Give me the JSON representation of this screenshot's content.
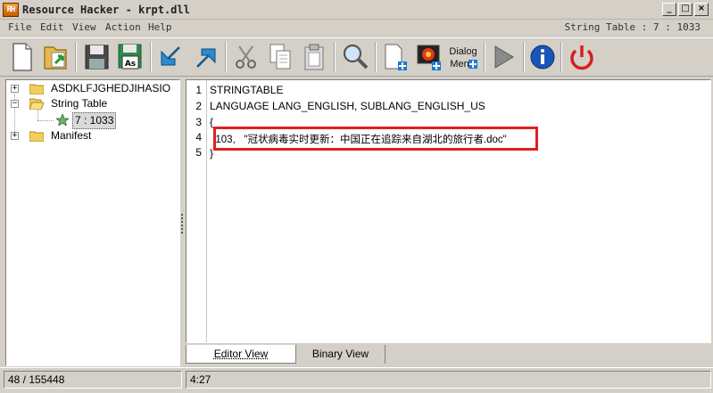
{
  "window": {
    "app_icon_text": "RH",
    "title": "Resource Hacker - krpt.dll",
    "min_glyph": "_",
    "max_glyph": "□",
    "close_glyph": "×"
  },
  "menu": {
    "file": "File",
    "edit": "Edit",
    "view": "View",
    "action": "Action",
    "help": "Help",
    "status": "String Table : 7 : 1033"
  },
  "toolbar": {
    "buttons": [
      {
        "name": "new-icon"
      },
      {
        "name": "open-folder-icon"
      },
      {
        "name": "save-icon"
      },
      {
        "name": "save-as-icon",
        "label": "As"
      },
      {
        "name": "import-arrow-icon"
      },
      {
        "name": "export-arrow-icon"
      },
      {
        "name": "cut-icon"
      },
      {
        "name": "copy-icon"
      },
      {
        "name": "paste-icon"
      },
      {
        "name": "find-icon"
      },
      {
        "name": "add-resource-icon"
      },
      {
        "name": "add-image-resource-icon"
      },
      {
        "name": "dialog-menu-icon"
      },
      {
        "name": "compile-run-icon"
      },
      {
        "name": "info-icon"
      },
      {
        "name": "power-icon"
      }
    ],
    "dialog_label_1": "Dialog",
    "dialog_label_2": "Men"
  },
  "tree": {
    "items": [
      {
        "label": "ASDKLFJGHEDJIHASIO",
        "expander": "+"
      },
      {
        "label": "String Table",
        "expander": "−"
      },
      {
        "label": "7 : 1033"
      },
      {
        "label": "Manifest",
        "expander": "+"
      }
    ]
  },
  "editor": {
    "line_numbers": [
      "1",
      "2",
      "3",
      "4",
      "5"
    ],
    "lines": [
      "STRINGTABLE",
      "LANGUAGE LANG_ENGLISH, SUBLANG_ENGLISH_US",
      "{",
      "  103,   \"冠状病毒实时更新：中国正在追踪来自湖北的旅行者.doc\"",
      "}"
    ]
  },
  "tabs": {
    "editor": "Editor View",
    "binary": "Binary View"
  },
  "status": {
    "left": "48 / 155448",
    "right": "4:27"
  },
  "colors": {
    "highlight_border": "#e02020",
    "chrome": "#d4d0c8"
  }
}
